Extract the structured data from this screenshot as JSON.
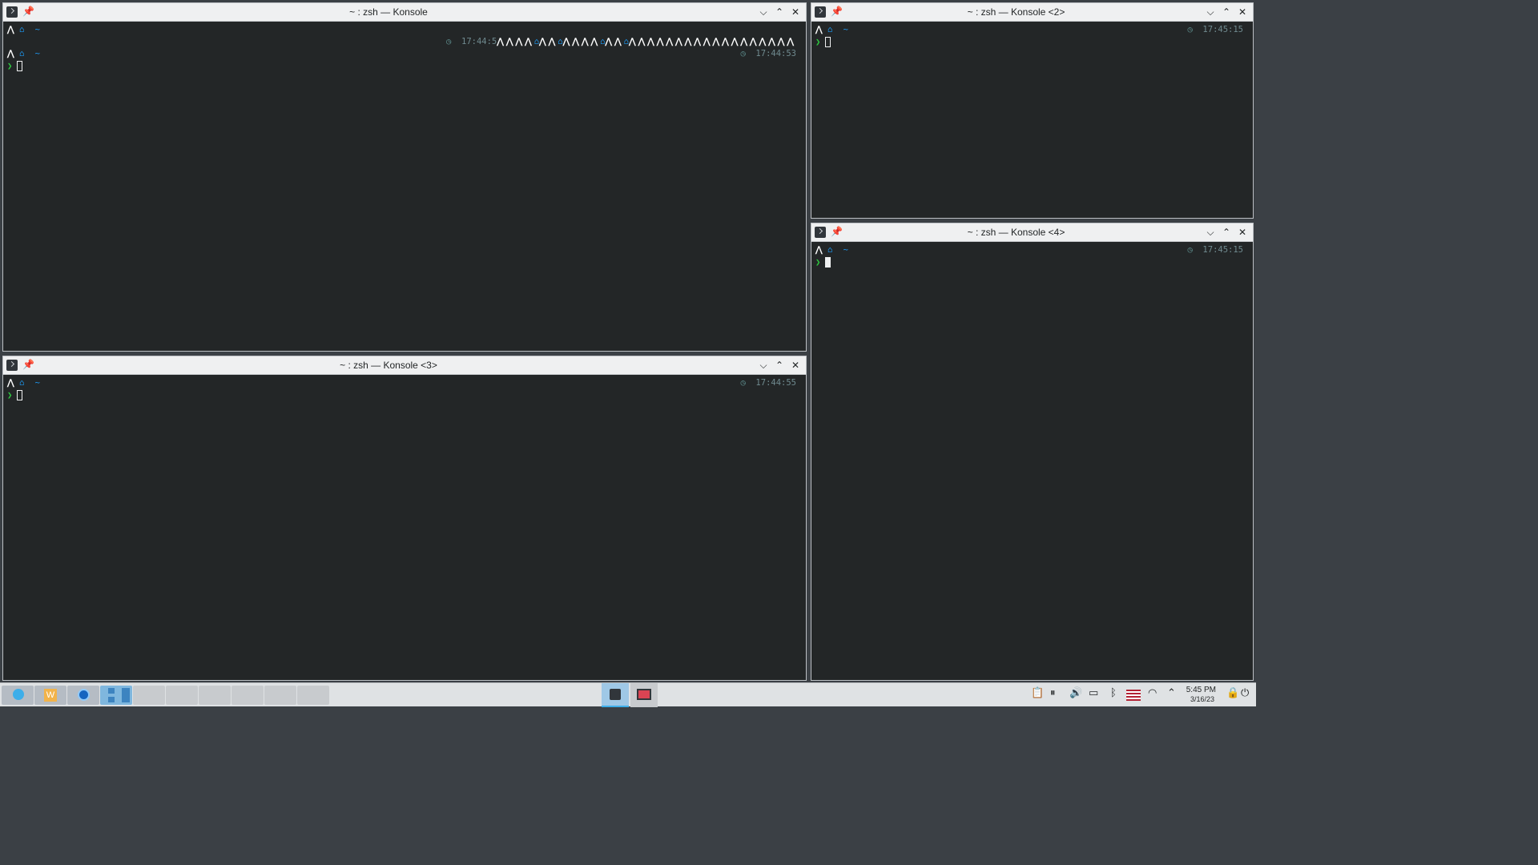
{
  "windows": [
    {
      "title": "~ : zsh — Konsole",
      "lines": [
        {
          "tilde": "~",
          "time": "17:44:5"
        },
        {
          "tilde": "~",
          "time": "17:44:53"
        }
      ]
    },
    {
      "title": "~ : zsh — Konsole <2>",
      "lines": [
        {
          "tilde": "~",
          "time": "17:45:15"
        }
      ]
    },
    {
      "title": "~ : zsh — Konsole <4>",
      "lines": [
        {
          "tilde": "~",
          "time": "17:45:15"
        }
      ]
    },
    {
      "title": "~ : zsh — Konsole <3>",
      "lines": [
        {
          "tilde": "~",
          "time": "17:44:55"
        }
      ]
    }
  ],
  "prompt_symbol": "❯",
  "titlebar_icons": {
    "pin": "pin-icon",
    "minimize": "chevron-down-icon",
    "maximize": "chevron-up-icon",
    "close": "close-icon"
  },
  "clock": {
    "time": "5:45 PM",
    "date": "3/16/23"
  },
  "colors": {
    "terminal_bg": "#232627",
    "accent": "#1d99f3",
    "prompt": "#2ecc40",
    "titlebar": "#eff0f1"
  }
}
